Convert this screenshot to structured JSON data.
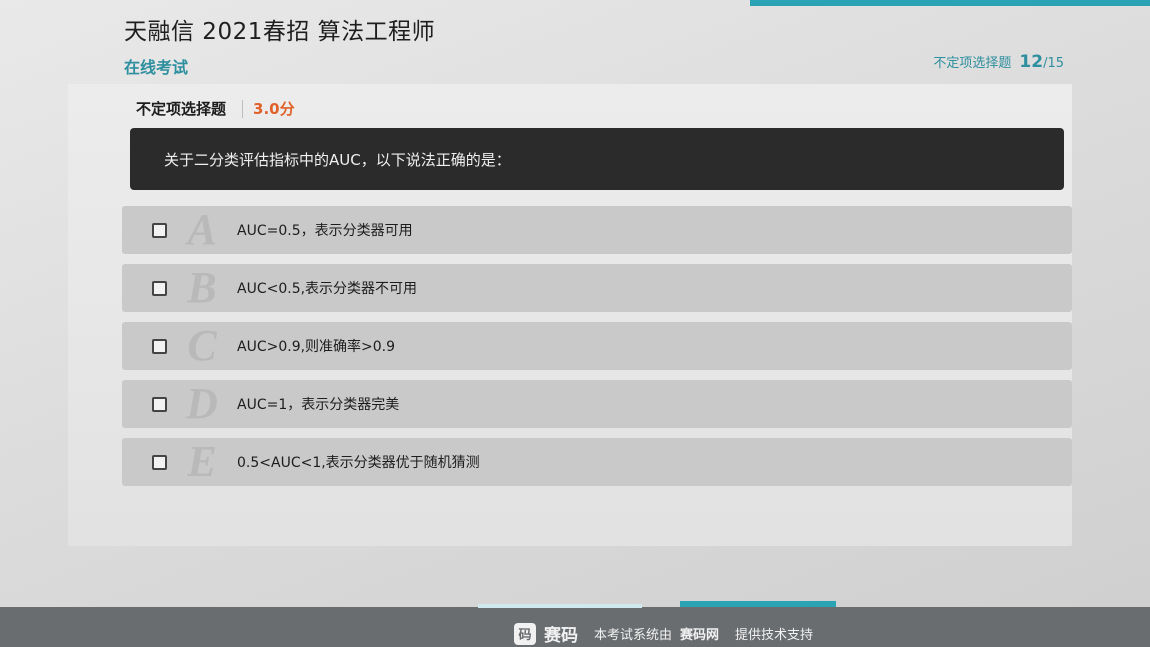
{
  "header": {
    "title": "天融信 2021春招 算法工程师",
    "subtitle": "在线考试"
  },
  "progress": {
    "type_label": "不定项选择题",
    "current": "12",
    "total": "/15"
  },
  "question": {
    "type": "不定项选择题",
    "score": "3.0分",
    "stem": "关于二分类评估指标中的AUC，以下说法正确的是："
  },
  "options": [
    {
      "letter": "A",
      "text": "AUC=0.5，表示分类器可用",
      "checked": false
    },
    {
      "letter": "B",
      "text": "AUC<0.5,表示分类器不可用",
      "checked": false
    },
    {
      "letter": "C",
      "text": "AUC>0.9,则准确率>0.9",
      "checked": false
    },
    {
      "letter": "D",
      "text": "AUC=1，表示分类器完美",
      "checked": false
    },
    {
      "letter": "E",
      "text": "0.5<AUC<1,表示分类器优于随机猜测",
      "checked": false
    }
  ],
  "footer": {
    "logo_glyph": "码",
    "brand": "赛码",
    "support_prefix": "本考试系统由",
    "support_brand": "赛码网",
    "support_suffix": "提供技术支持"
  },
  "colors": {
    "accent": "#2aa3b5",
    "score": "#e0612a",
    "stem_bg": "#2b2b2b"
  }
}
